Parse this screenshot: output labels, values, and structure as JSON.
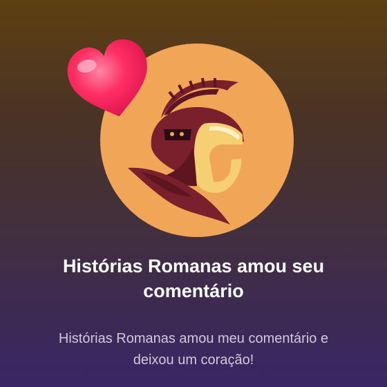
{
  "notification": {
    "title": "Histórias Romanas amou seu comentário",
    "message": "Histórias Romanas amou meu comentário e deixou um coração!",
    "avatar_icon": "spartan-helmet-icon",
    "reaction_icon": "heart-icon"
  },
  "colors": {
    "avatar_background": "#f1a557",
    "helmet_crest": "#7a1f2c",
    "heart": "#ff2e63",
    "title_text": "#ffffff",
    "message_text": "#d3c9d9"
  }
}
